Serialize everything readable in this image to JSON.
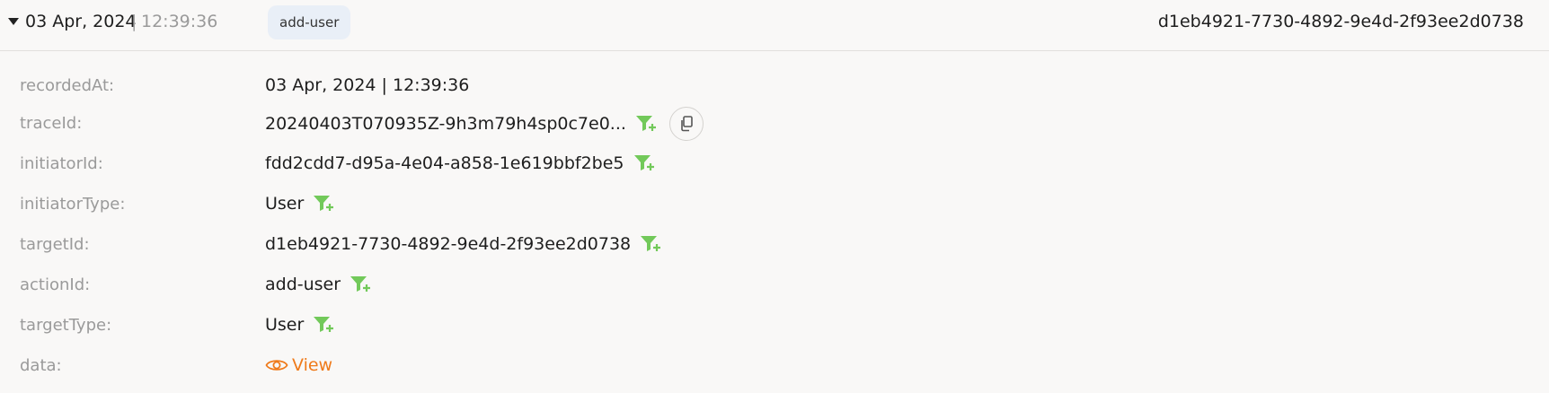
{
  "header": {
    "date": "03 Apr, 2024",
    "separator": "|",
    "time": "12:39:36",
    "action_chip": "add-user",
    "target_id": "d1eb4921-7730-4892-9e4d-2f93ee2d0738"
  },
  "fields": {
    "recordedAt": {
      "label": "recordedAt:",
      "value": "03 Apr, 2024 | 12:39:36"
    },
    "traceId": {
      "label": "traceId:",
      "value": "20240403T070935Z-9h3m79h4sp0c7e0..."
    },
    "initiatorId": {
      "label": "initiatorId:",
      "value": "fdd2cdd7-d95a-4e04-a858-1e619bbf2be5"
    },
    "initiatorType": {
      "label": "initiatorType:",
      "value": "User"
    },
    "targetId": {
      "label": "targetId:",
      "value": "d1eb4921-7730-4892-9e4d-2f93ee2d0738"
    },
    "actionId": {
      "label": "actionId:",
      "value": "add-user"
    },
    "targetType": {
      "label": "targetType:",
      "value": "User"
    },
    "data": {
      "label": "data:",
      "link": "View"
    }
  },
  "icons": {
    "filter": "filter-plus-icon",
    "copy": "copy-icon",
    "view": "eye-icon",
    "expand": "caret-down-icon"
  },
  "colors": {
    "filter_icon": "#72c95a",
    "view_link": "#ef7a1a",
    "chip_bg": "#e9eff7",
    "label": "#9a9a9a",
    "background": "#f9f8f7"
  }
}
